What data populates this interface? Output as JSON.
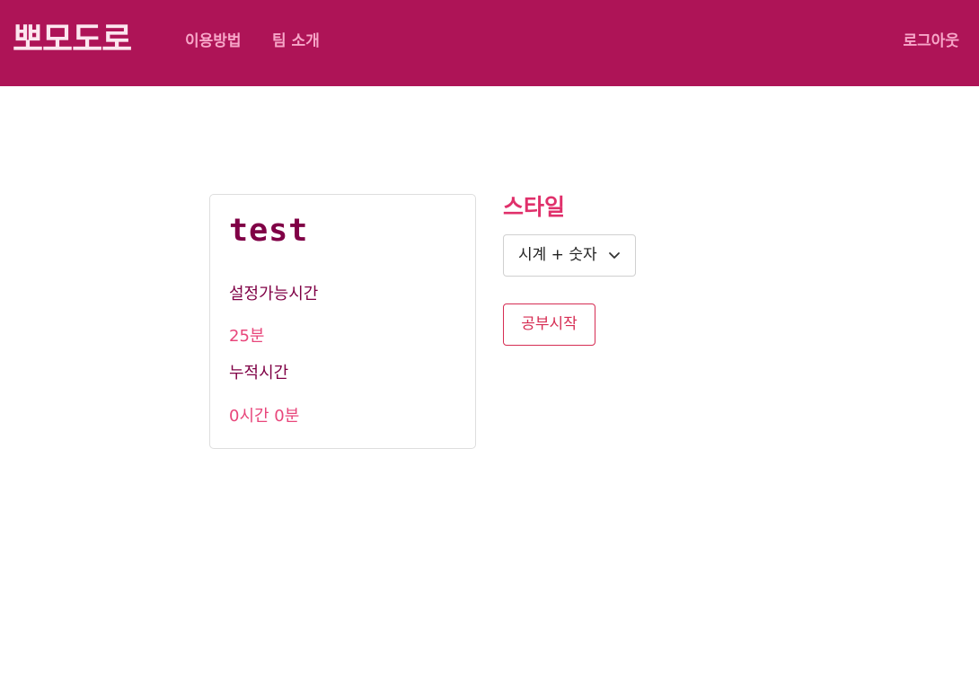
{
  "navbar": {
    "logo": "뽀모도로",
    "links": {
      "how_to_use": "이용방법",
      "team_intro": "팀 소개"
    },
    "logout": "로그아웃"
  },
  "colors": {
    "navbar_bg": "#ae1457",
    "nav_link": "#f7a6c8",
    "card_title": "#800046",
    "value_accent": "#e8467b",
    "style_title": "#e0306b",
    "start_button": "#d62d53"
  },
  "profile_card": {
    "name": "test",
    "settable_time_label": "설정가능시간",
    "settable_time_value": "25분",
    "accumulated_time_label": "누적시간",
    "accumulated_time_value": "0시간 0분"
  },
  "style_panel": {
    "title": "스타일",
    "selected_style": "시계 + 숫자",
    "select_icon": "chevron-down-icon",
    "start_button": "공부시작"
  }
}
